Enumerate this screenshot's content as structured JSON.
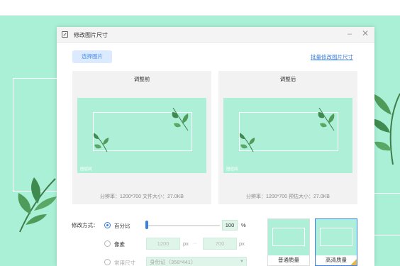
{
  "dialog": {
    "title": "修改图片尺寸",
    "minimize_glyph": "–",
    "close_glyph": "✕",
    "select_image_label": "选择图片",
    "batch_link_label": "批量修改图片尺寸"
  },
  "before": {
    "title": "调整前",
    "watermark": "图层网",
    "info": "分辨率：1200*700   文件大小：27.0KB"
  },
  "after": {
    "title": "调整后",
    "watermark": "图层网",
    "info": "分辨率：1200*700   预估大小：27.0KB"
  },
  "controls": {
    "mode_label": "修改方式：",
    "percent_option": "百分比",
    "percent_value": "100",
    "percent_unit": "%",
    "slider_fraction": 0.0,
    "pixel_option": "像素",
    "width_value": "1200",
    "height_value": "700",
    "px_unit": "px",
    "common_option": "常用尺寸",
    "common_select_value": "身份证（358*441）",
    "selected_mode": "percent"
  },
  "quality": {
    "normal_label": "普通质量",
    "high_label": "高清质量",
    "selected": "high"
  },
  "colors": {
    "accent": "#3b7fe0",
    "mint": "#aaf0d6"
  },
  "icons": {
    "title": "resize-icon",
    "link": "link-icon"
  }
}
